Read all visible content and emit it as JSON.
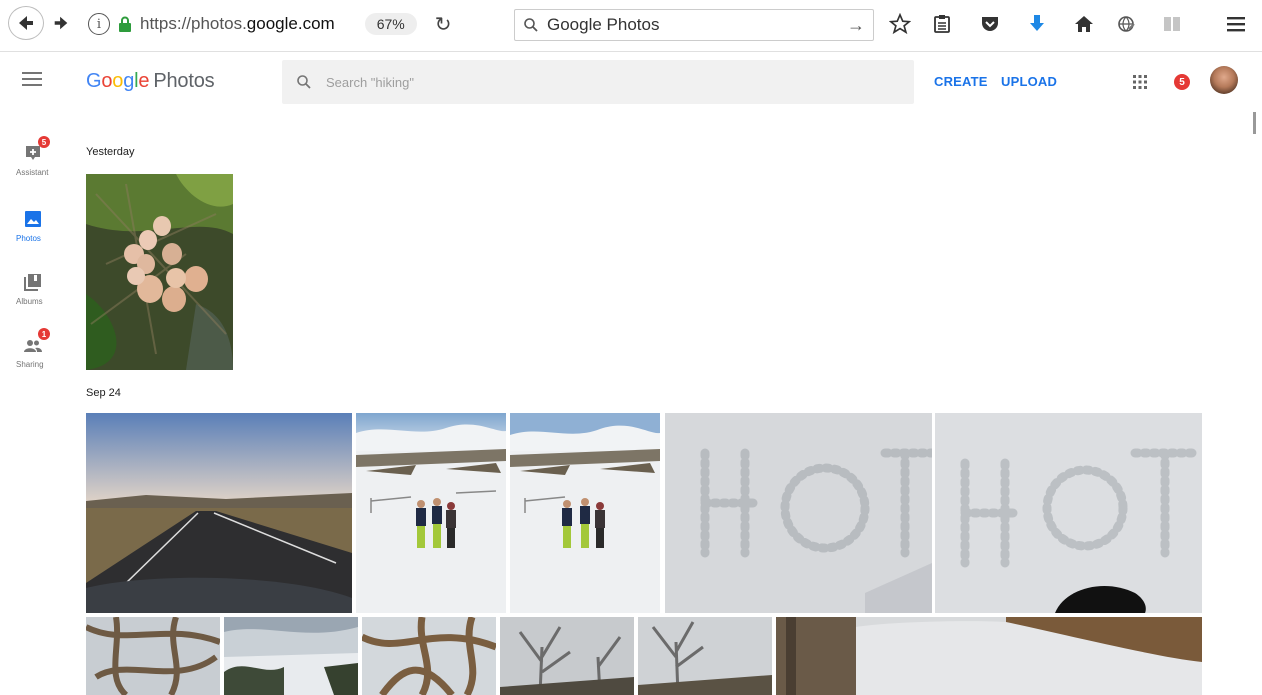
{
  "browser": {
    "url_prefix": "https://photos.",
    "url_domain": "google.com",
    "zoom": "67%",
    "search_text": "Google Photos"
  },
  "app": {
    "logo_text": "Google",
    "logo_product": "Photos",
    "search_placeholder": "Search \"hiking\"",
    "create_label": "CREATE",
    "upload_label": "UPLOAD",
    "notification_count": "5"
  },
  "nav": {
    "items": [
      {
        "label": "Assistant",
        "badge": "5"
      },
      {
        "label": "Photos",
        "badge": ""
      },
      {
        "label": "Albums",
        "badge": ""
      },
      {
        "label": "Sharing",
        "badge": "1"
      }
    ]
  },
  "sections": [
    {
      "date": "Yesterday"
    },
    {
      "date": "Sep 24"
    }
  ],
  "colors": {
    "accent": "#1a73e8",
    "badge": "#e53935"
  }
}
